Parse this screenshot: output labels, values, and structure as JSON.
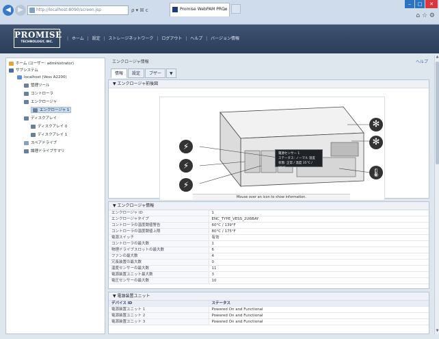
{
  "browser": {
    "back_icon": "back-arrow",
    "forward_icon": "forward-arrow",
    "address": "http://localhost:8090/screen.jsp",
    "address_tools": "ρ ▾ ☒ ᴄ",
    "tab_title": "Promise WebPAM PROe",
    "tab_close": "×",
    "win_min": "‒",
    "win_max": "□",
    "win_close": "✕",
    "tools_icons": "⌂ ☆ ⚙"
  },
  "app": {
    "logo_line1": "PROMISE",
    "logo_line2": "TECHNOLOGY, INC.",
    "menu": [
      "ホーム",
      "設定",
      "ストレージネットワーク",
      "ログアウト",
      "ヘルプ",
      "バージョン情報"
    ],
    "menu_sep": "|"
  },
  "tree": {
    "items": [
      {
        "label": "ホーム (ユーザー: administrator)"
      },
      {
        "label": "サブシステム"
      },
      {
        "label": "localhost (Vess A2200)"
      },
      {
        "label": "管理ツール"
      },
      {
        "label": "コントローラ"
      },
      {
        "label": "エンクロージャ"
      },
      {
        "label": "エンクロージャ 1"
      },
      {
        "label": "ディスクアレイ"
      },
      {
        "label": "ディスクアレイ 0"
      },
      {
        "label": "ディスクアレイ 1"
      },
      {
        "label": "スペアドライブ"
      },
      {
        "label": "論理ドライブサマリ"
      }
    ]
  },
  "main": {
    "breadcrumb": "エンクロージャ情報",
    "help": "ヘルプ",
    "tabs": [
      "情報",
      "設定",
      "ブザー"
    ],
    "tab_dropdown": "▼",
    "diagram_section_title": "▼ エンクロージャ前後図",
    "tooltip_lines": [
      "電源センサー 1",
      "ステータス: ノーマル 温度",
      "状態: 正常 / 温度 35°C / 95°F"
    ],
    "mouse_hint": "Mouse over an icon to show information.",
    "fan_icon": "fan",
    "volt_icon": "power-bolt",
    "temp_icon": "thermometer"
  },
  "enclosure_info": {
    "title": "▼ エンクロージャ情報",
    "rows": [
      {
        "key": "エンクロージャ ID",
        "value": "1"
      },
      {
        "key": "エンクロージャタイプ",
        "value": "ENC_TYPE_VESS_2U6BAY"
      },
      {
        "key": "コントローラの温度閾値警告",
        "value": "60°C / 139°F"
      },
      {
        "key": "コントローラの温度閾値上限",
        "value": "80°C / 175°F"
      },
      {
        "key": "電源スイッチ",
        "value": "有効"
      },
      {
        "key": "コントローラの最大数",
        "value": "1"
      },
      {
        "key": "物理ドライブスロットの最大数",
        "value": "6"
      },
      {
        "key": "ファンの最大数",
        "value": "4"
      },
      {
        "key": "冗長装置の最大数",
        "value": "0"
      },
      {
        "key": "温度センサーの最大数",
        "value": "11"
      },
      {
        "key": "電源装置ユニット最大数",
        "value": "3"
      },
      {
        "key": "電圧センサーの最大数",
        "value": "10"
      }
    ]
  },
  "psu": {
    "title": "▼ 電源装置ユニット",
    "header": {
      "key": "デバイス ID",
      "value": "ステータス"
    },
    "rows": [
      {
        "key": "電源装置ユニット 1",
        "value": "Powered On and Functional"
      },
      {
        "key": "電源装置ユニット 2",
        "value": "Powered On and Functional"
      },
      {
        "key": "電源装置ユニット 3",
        "value": "Powered On and Functional"
      }
    ]
  },
  "colors": {
    "appbar": "#2b3e59",
    "accent": "#3a79c8",
    "close": "#d9363e"
  }
}
